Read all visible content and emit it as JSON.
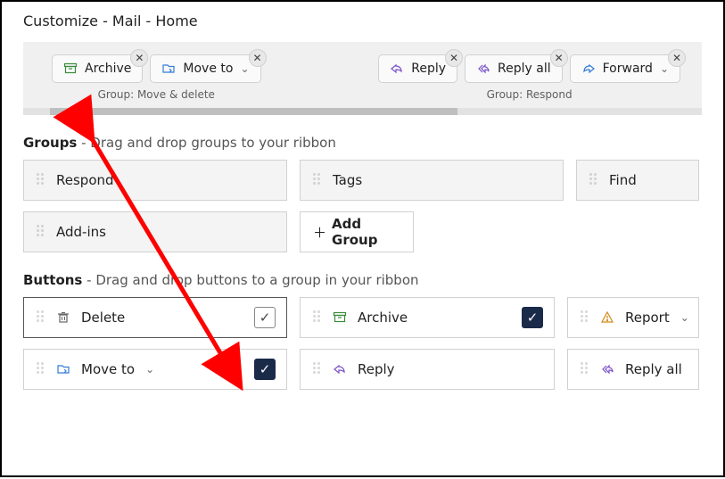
{
  "page_title": "Customize - Mail - Home",
  "ribbon": {
    "groups": [
      {
        "caption": "Group: Move & delete",
        "buttons": [
          {
            "label": "Archive",
            "icon": "archive-icon",
            "dropdown": false
          },
          {
            "label": "Move to",
            "icon": "move-icon",
            "dropdown": true
          }
        ]
      },
      {
        "caption": "Group: Respond",
        "buttons": [
          {
            "label": "Reply",
            "icon": "reply-icon",
            "dropdown": false
          },
          {
            "label": "Reply all",
            "icon": "replyall-icon",
            "dropdown": false
          },
          {
            "label": "Forward",
            "icon": "forward-icon",
            "dropdown": true
          }
        ]
      }
    ]
  },
  "groups_section": {
    "title": "Groups",
    "subtitle": " - Drag and drop groups to your ribbon",
    "items": [
      [
        "Respond",
        "Tags",
        "Find"
      ],
      [
        "Add-ins"
      ]
    ],
    "add_group_label": "Add Group"
  },
  "buttons_section": {
    "title": "Buttons",
    "subtitle": " - Drag and drop buttons to a group in your ribbon",
    "rows": [
      [
        {
          "label": "Delete",
          "icon": "delete-icon",
          "checked": false,
          "dropdown": false
        },
        {
          "label": "Archive",
          "icon": "archive-icon",
          "checked": true,
          "dropdown": false
        },
        {
          "label": "Report",
          "icon": "report-icon",
          "checked": null,
          "dropdown": true
        }
      ],
      [
        {
          "label": "Move to",
          "icon": "move-icon",
          "checked": true,
          "dropdown": true
        },
        {
          "label": "Reply",
          "icon": "reply-icon",
          "checked": null,
          "dropdown": false
        },
        {
          "label": "Reply all",
          "icon": "replyall-icon",
          "checked": null,
          "dropdown": false
        }
      ]
    ]
  },
  "colors": {
    "accent_check": "#1a2a49",
    "ribbon_bg": "#f0f0f0",
    "tile_bg": "#f4f4f4",
    "border": "#d1d1d1",
    "arrow": "#ff0000"
  }
}
